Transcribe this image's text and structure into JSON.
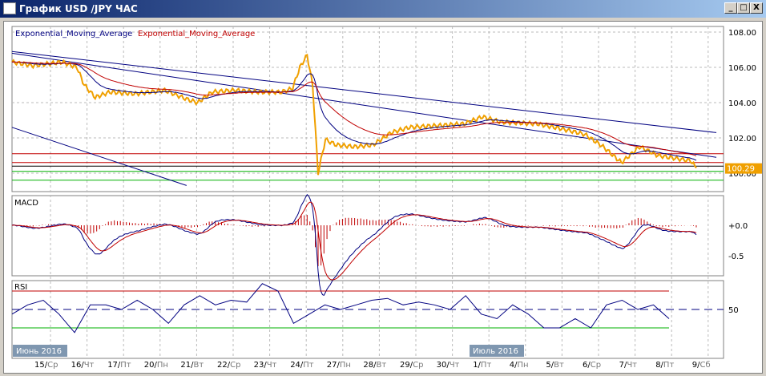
{
  "window": {
    "title": "График USD /JPY  ЧАС",
    "minimize": "_",
    "maximize": "□",
    "close": "X"
  },
  "legend": {
    "ema1": "Exponential_Moving_Average",
    "ema2": "Exponential_Moving_Average"
  },
  "price_axis": {
    "ticks": [
      "108.00",
      "106.00",
      "104.00",
      "102.00",
      "100.00"
    ],
    "current": "100.29"
  },
  "macd_panel": {
    "label": "MACD",
    "ticks": [
      "+0.0",
      "-0.5"
    ]
  },
  "rsi_panel": {
    "label": "RSI",
    "ticks": [
      "50"
    ]
  },
  "month_labels": [
    "Июнь 2016",
    "Июль 2016"
  ],
  "dates": [
    {
      "d": "15/",
      "w": "Ср"
    },
    {
      "d": "16/",
      "w": "Чт"
    },
    {
      "d": "17/",
      "w": "Пт"
    },
    {
      "d": "20/",
      "w": "Пн"
    },
    {
      "d": "21/",
      "w": "Вт"
    },
    {
      "d": "22/",
      "w": "Ср"
    },
    {
      "d": "23/",
      "w": "Чт"
    },
    {
      "d": "24/",
      "w": "Пт"
    },
    {
      "d": "27/",
      "w": "Пн"
    },
    {
      "d": "28/",
      "w": "Вт"
    },
    {
      "d": "29/",
      "w": "Ср"
    },
    {
      "d": "30/",
      "w": "Чт"
    },
    {
      "d": "1/",
      "w": "Пт"
    },
    {
      "d": "4/",
      "w": "Пн"
    },
    {
      "d": "5/",
      "w": "Вт"
    },
    {
      "d": "6/",
      "w": "Ср"
    },
    {
      "d": "7/",
      "w": "Чт"
    },
    {
      "d": "8/",
      "w": "Пт"
    },
    {
      "d": "9/",
      "w": "Сб"
    }
  ],
  "colors": {
    "price": "#f0a000",
    "ema_fast": "#000080",
    "ema_slow": "#c00000",
    "trend": "#000080",
    "resist": "#c00000",
    "support": "#00b000",
    "hist": "#c00000"
  },
  "chart_data": {
    "type": "line",
    "title": "USD/JPY H1",
    "ylim": [
      99.0,
      108.5
    ],
    "price": [
      [
        -0.88,
        106.3
      ],
      [
        -0.3,
        106.1
      ],
      [
        0.5,
        106.3
      ],
      [
        0.9,
        106.0
      ],
      [
        1.1,
        105.0
      ],
      [
        1.4,
        104.3
      ],
      [
        1.8,
        104.6
      ],
      [
        2.5,
        104.5
      ],
      [
        3.3,
        104.7
      ],
      [
        3.9,
        104.2
      ],
      [
        4.2,
        104.0
      ],
      [
        4.6,
        104.6
      ],
      [
        5.2,
        104.7
      ],
      [
        5.9,
        104.6
      ],
      [
        6.5,
        104.6
      ],
      [
        6.8,
        104.8
      ],
      [
        7.0,
        106.0
      ],
      [
        7.2,
        106.7
      ],
      [
        7.35,
        105.0
      ],
      [
        7.5,
        100.0
      ],
      [
        7.7,
        101.9
      ],
      [
        8.0,
        101.6
      ],
      [
        8.5,
        101.5
      ],
      [
        9.0,
        101.6
      ],
      [
        9.5,
        102.3
      ],
      [
        10.0,
        102.6
      ],
      [
        10.8,
        102.7
      ],
      [
        11.5,
        102.8
      ],
      [
        12.0,
        103.2
      ],
      [
        12.5,
        102.9
      ],
      [
        13.5,
        102.8
      ],
      [
        14.2,
        102.5
      ],
      [
        14.8,
        102.2
      ],
      [
        15.3,
        101.5
      ],
      [
        15.8,
        100.6
      ],
      [
        16.3,
        101.5
      ],
      [
        16.8,
        101.0
      ],
      [
        17.4,
        100.8
      ],
      [
        17.7,
        100.7
      ],
      [
        17.85,
        100.29
      ]
    ],
    "trend_lines": [
      [
        [
          -0.88,
          106.9
        ],
        [
          18.4,
          102.3
        ]
      ],
      [
        [
          -0.88,
          106.8
        ],
        [
          18.4,
          100.9
        ]
      ],
      [
        [
          -0.88,
          102.6
        ],
        [
          3.9,
          99.3
        ]
      ]
    ],
    "horizontal_levels": [
      101.1,
      100.6,
      100.4,
      100.1,
      99.6
    ],
    "rsi": [
      45,
      55,
      60,
      45,
      25,
      55,
      55,
      50,
      60,
      50,
      35,
      55,
      65,
      55,
      60,
      58,
      78,
      70,
      35,
      45,
      55,
      50,
      55,
      60,
      62,
      55,
      58,
      55,
      50,
      65,
      45,
      40,
      55,
      45,
      30,
      30,
      40,
      30,
      55,
      60,
      50,
      55,
      40
    ]
  }
}
